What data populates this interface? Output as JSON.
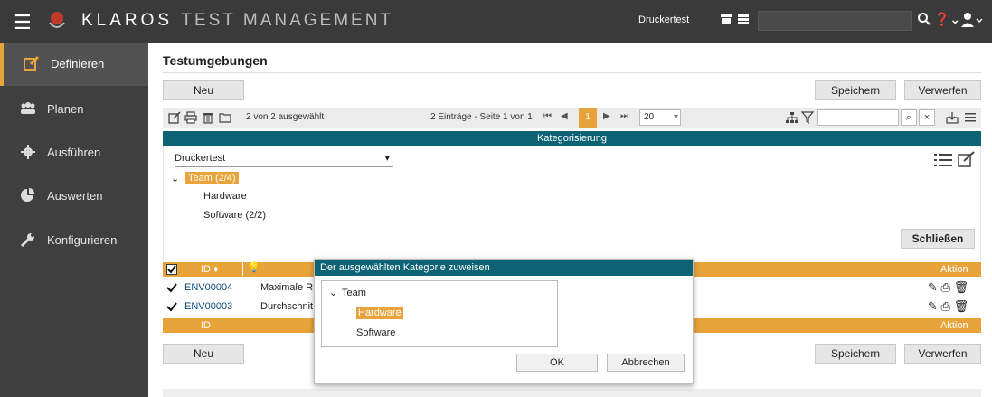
{
  "app": {
    "brand_bold": "KLAROS",
    "brand_light": "TEST MANAGEMENT",
    "project": "Druckertest",
    "colors": {
      "topbar": "#3a3a3a",
      "sidebar": "#3f3f3f",
      "accent": "#e8a33a",
      "teal": "#0d6374"
    }
  },
  "sidebar": {
    "items": [
      {
        "label": "Definieren",
        "icon": "edit-icon"
      },
      {
        "label": "Planen",
        "icon": "users-icon"
      },
      {
        "label": "Ausführen",
        "icon": "gear-icon"
      },
      {
        "label": "Auswerten",
        "icon": "pie-chart-icon"
      },
      {
        "label": "Konfigurieren",
        "icon": "wrench-icon"
      }
    ]
  },
  "page": {
    "title": "Testumgebungen",
    "new_label": "Neu",
    "save_label": "Speichern",
    "discard_label": "Verwerfen"
  },
  "toolbar": {
    "selected": "2 von 2 ausgewählt",
    "paging": "2 Einträge - Seite 1 von 1",
    "current_page": "1",
    "page_size": "20",
    "clear_filter": "×"
  },
  "categorization": {
    "header": "Kategorisierung",
    "selected_tree": "Druckertest",
    "root": "Team (2/4)",
    "children": [
      "Hardware",
      "Software (2/2)"
    ],
    "close_label": "Schließen"
  },
  "grid": {
    "col_id": "ID ♦",
    "col_action": "Aktion",
    "footer_id": "ID",
    "rows": [
      {
        "id": "ENV00004",
        "name": "Maximale R"
      },
      {
        "id": "ENV00003",
        "name": "Durchschnit"
      }
    ]
  },
  "dialog": {
    "title": "Der ausgewählten Kategorie zuweisen",
    "root": "Team",
    "items": [
      "Hardware",
      "Software"
    ],
    "ok_label": "OK",
    "cancel_label": "Abbrechen"
  }
}
